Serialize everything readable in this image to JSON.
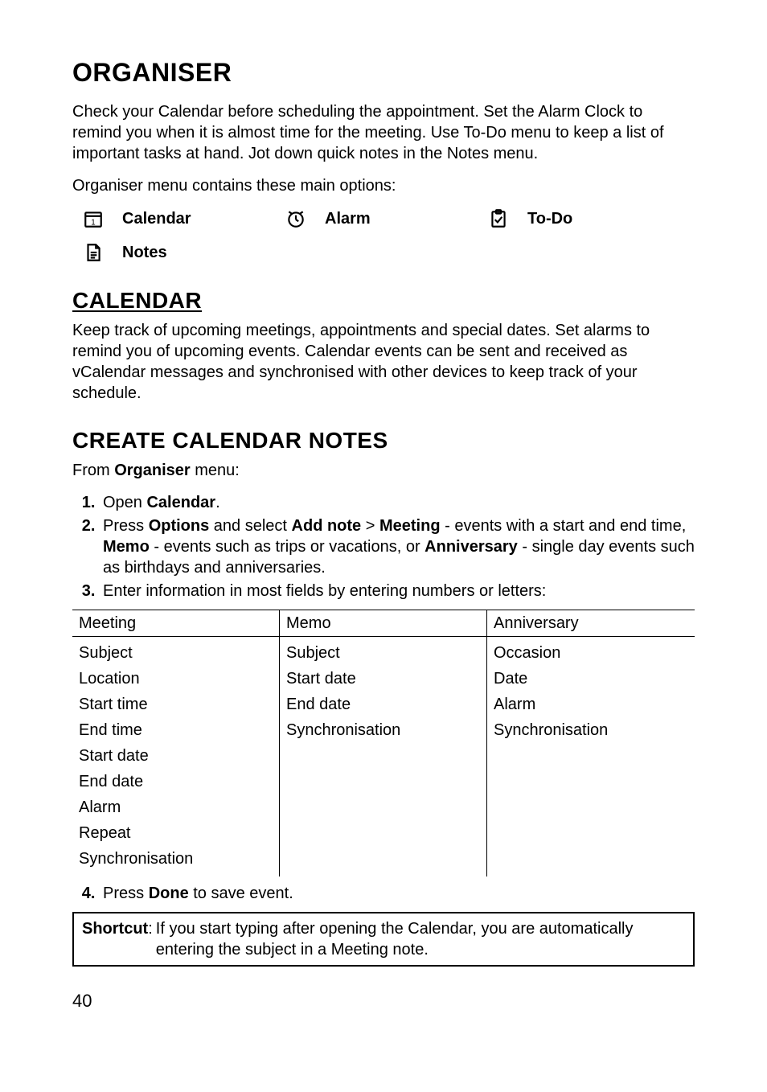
{
  "title": "ORGANISER",
  "intro": "Check your Calendar before scheduling the appointment. Set the Alarm Clock to remind you when it is almost time for the meeting. Use To-Do menu to keep a list of important tasks at hand. Jot down quick notes in the Notes menu.",
  "options_intro": "Organiser menu contains these main options:",
  "options": {
    "calendar": "Calendar",
    "alarm": "Alarm",
    "todo": "To-Do",
    "notes": "Notes"
  },
  "calendar": {
    "heading": "CALENDAR",
    "desc": "Keep track of upcoming meetings, appointments and special dates. Set alarms to remind you of upcoming events. Calendar events can be sent and received as vCalendar messages and synchronised with other devices to keep track of your schedule."
  },
  "create": {
    "heading": "CREATE CALENDAR NOTES",
    "from_prefix": "From ",
    "from_bold": "Organiser",
    "from_suffix": " menu:",
    "steps": {
      "s1_a": "Open ",
      "s1_b": "Calendar",
      "s1_c": ".",
      "s2_a": "Press ",
      "s2_b": "Options",
      "s2_c": " and select  ",
      "s2_d": "Add note",
      "s2_e": " > ",
      "s2_f": "Meeting",
      "s2_g": " - events with a start and end time, ",
      "s2_h": "Memo",
      "s2_i": " - events such as trips or vacations, or ",
      "s2_j": "Anniversary",
      "s2_k": " - single day events such as birthdays and anniversaries.",
      "s3": "Enter information in most fields by entering numbers or letters:",
      "s4_a": "Press ",
      "s4_b": "Done",
      "s4_c": " to save event."
    }
  },
  "table": {
    "meeting": {
      "header": "Meeting",
      "rows": [
        "Subject",
        "Location",
        "Start time",
        "End time",
        "Start date",
        "End date",
        "Alarm",
        "Repeat",
        "Synchronisation"
      ]
    },
    "memo": {
      "header": "Memo",
      "rows": [
        "Subject",
        "Start date",
        "End date",
        "Synchronisation"
      ]
    },
    "anniversary": {
      "header": "Anniversary",
      "rows": [
        "Occasion",
        "Date",
        "Alarm",
        "Synchronisation"
      ]
    }
  },
  "shortcut": {
    "label": "Shortcut",
    "colon": ": ",
    "text": "If you start typing after opening the Calendar, you are automatically entering the subject in a Meeting note."
  },
  "page_number": "40"
}
